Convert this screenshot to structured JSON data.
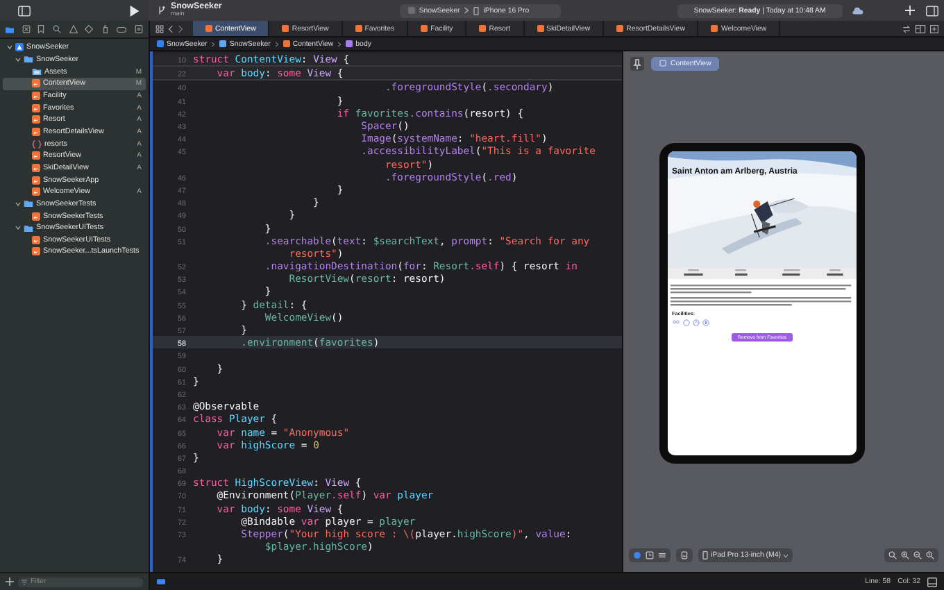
{
  "toolbar": {
    "project": "SnowSeeker",
    "branch": "main",
    "scheme": "SnowSeeker",
    "destination": "iPhone 16 Pro",
    "activity": "SnowSeeker: **Ready** | Today at 10:48 AM"
  },
  "tabs": [
    {
      "label": "ContentView",
      "selected": true
    },
    {
      "label": "ResortView",
      "selected": false
    },
    {
      "label": "Favorites",
      "selected": false
    },
    {
      "label": "Facility",
      "selected": false
    },
    {
      "label": "Resort",
      "selected": false
    },
    {
      "label": "SkiDetailView",
      "selected": false
    },
    {
      "label": "ResortDetailsView",
      "selected": false
    },
    {
      "label": "WelcomeView",
      "selected": false
    }
  ],
  "breadcrumb": [
    {
      "label": "SnowSeeker",
      "kind": "project"
    },
    {
      "label": "SnowSeeker",
      "kind": "folder"
    },
    {
      "label": "ContentView",
      "kind": "swift"
    },
    {
      "label": "body",
      "kind": "property"
    }
  ],
  "navigator": {
    "items": [
      {
        "label": "SnowSeeker",
        "kind": "project",
        "expanded": true,
        "selected": false,
        "children": [
          {
            "label": "SnowSeeker",
            "kind": "folder",
            "expanded": true,
            "selected": false,
            "children": [
              {
                "label": "Assets",
                "kind": "assets",
                "status": "M",
                "selected": false
              },
              {
                "label": "ContentView",
                "kind": "swift",
                "status": "M",
                "selected": true
              },
              {
                "label": "Facility",
                "kind": "swift",
                "status": "A",
                "selected": false
              },
              {
                "label": "Favorites",
                "kind": "swift",
                "status": "A",
                "selected": false
              },
              {
                "label": "Resort",
                "kind": "swift",
                "status": "A",
                "selected": false
              },
              {
                "label": "ResortDetailsView",
                "kind": "swift",
                "status": "A",
                "selected": false
              },
              {
                "label": "resorts",
                "kind": "json",
                "status": "A",
                "selected": false
              },
              {
                "label": "ResortView",
                "kind": "swift",
                "status": "A",
                "selected": false
              },
              {
                "label": "SkiDetailView",
                "kind": "swift",
                "status": "A",
                "selected": false
              },
              {
                "label": "SnowSeekerApp",
                "kind": "swift",
                "selected": false
              },
              {
                "label": "WelcomeView",
                "kind": "swift",
                "status": "A",
                "selected": false
              }
            ]
          },
          {
            "label": "SnowSeekerTests",
            "kind": "folder",
            "expanded": true,
            "selected": false,
            "children": [
              {
                "label": "SnowSeekerTests",
                "kind": "swift",
                "selected": false
              }
            ]
          },
          {
            "label": "SnowSeekerUITests",
            "kind": "folder",
            "expanded": true,
            "selected": false,
            "children": [
              {
                "label": "SnowSeekerUITests",
                "kind": "swift",
                "selected": false
              },
              {
                "label": "SnowSeeker...tsLaunchTests",
                "kind": "swift",
                "selected": false
              }
            ]
          }
        ]
      }
    ],
    "filter": {
      "placeholder": "Filter"
    }
  },
  "editor": {
    "lines": [
      {
        "n": "10",
        "kind": "sticky",
        "t": [
          {
            "kind": "kw",
            "text": "struct"
          },
          {
            "kind": "decl",
            "text": " ContentView"
          },
          {
            "kind": "p",
            "text": ": "
          },
          {
            "kind": "type",
            "text": "View"
          },
          {
            "kind": "p",
            "text": " {"
          }
        ]
      },
      {
        "n": "22",
        "kind": "sticky",
        "t": [
          {
            "kind": "kw",
            "text": "    var"
          },
          {
            "kind": "decl",
            "text": " body"
          },
          {
            "kind": "p",
            "text": ": "
          },
          {
            "kind": "kw",
            "text": "some"
          },
          {
            "kind": "type",
            "text": " View"
          },
          {
            "kind": "p",
            "text": " {"
          }
        ]
      },
      {
        "n": "40",
        "kind": "code",
        "t": [
          {
            "kind": "sys",
            "text": "                                .foregroundStyle"
          },
          {
            "kind": "p",
            "text": "("
          },
          {
            "kind": "sys",
            "text": ".secondary"
          },
          {
            "kind": "p",
            "text": ")"
          }
        ]
      },
      {
        "n": "41",
        "kind": "code",
        "t": [
          {
            "kind": "p",
            "text": "                        }"
          }
        ]
      },
      {
        "n": "42",
        "kind": "code",
        "t": [
          {
            "kind": "kw",
            "text": "                        if"
          },
          {
            "kind": "proj",
            "text": " favorites"
          },
          {
            "kind": "sys",
            "text": ".contains"
          },
          {
            "kind": "p",
            "text": "(resort) {"
          }
        ]
      },
      {
        "n": "43",
        "kind": "code",
        "t": [
          {
            "kind": "sys",
            "text": "                            Spacer"
          },
          {
            "kind": "p",
            "text": "()"
          }
        ]
      },
      {
        "n": "44",
        "kind": "code",
        "t": [
          {
            "kind": "sys",
            "text": "                            Image"
          },
          {
            "kind": "p",
            "text": "("
          },
          {
            "kind": "sys",
            "text": "systemName"
          },
          {
            "kind": "p",
            "text": ": "
          },
          {
            "kind": "str",
            "text": "\"heart.fill\""
          },
          {
            "kind": "p",
            "text": ")"
          }
        ]
      },
      {
        "n": "45",
        "kind": "code",
        "t": [
          {
            "kind": "sys",
            "text": "                            .accessibilityLabel"
          },
          {
            "kind": "p",
            "text": "("
          },
          {
            "kind": "str",
            "text": "\"This is a favorite"
          }
        ]
      },
      {
        "kind": "wrap",
        "t": [
          {
            "kind": "str",
            "text": "                                resort\""
          },
          {
            "kind": "p",
            "text": ")"
          }
        ]
      },
      {
        "n": "46",
        "kind": "code",
        "t": [
          {
            "kind": "sys",
            "text": "                                .foregroundStyle"
          },
          {
            "kind": "p",
            "text": "("
          },
          {
            "kind": "sys",
            "text": ".red"
          },
          {
            "kind": "p",
            "text": ")"
          }
        ]
      },
      {
        "n": "47",
        "kind": "code",
        "t": [
          {
            "kind": "p",
            "text": "                        }"
          }
        ]
      },
      {
        "n": "48",
        "kind": "code",
        "t": [
          {
            "kind": "p",
            "text": "                    }"
          }
        ]
      },
      {
        "n": "49",
        "kind": "code",
        "t": [
          {
            "kind": "p",
            "text": "                }"
          }
        ]
      },
      {
        "n": "50",
        "kind": "code",
        "t": [
          {
            "kind": "p",
            "text": "            }"
          }
        ]
      },
      {
        "n": "51",
        "kind": "code",
        "t": [
          {
            "kind": "sys",
            "text": "            .searchable"
          },
          {
            "kind": "p",
            "text": "("
          },
          {
            "kind": "sys",
            "text": "text"
          },
          {
            "kind": "p",
            "text": ": "
          },
          {
            "kind": "proj",
            "text": "$searchText"
          },
          {
            "kind": "p",
            "text": ", "
          },
          {
            "kind": "sys",
            "text": "prompt"
          },
          {
            "kind": "p",
            "text": ": "
          },
          {
            "kind": "str",
            "text": "\"Search for any"
          }
        ]
      },
      {
        "kind": "wrap",
        "t": [
          {
            "kind": "str",
            "text": "                resorts\""
          },
          {
            "kind": "p",
            "text": ")"
          }
        ]
      },
      {
        "n": "52",
        "kind": "code",
        "t": [
          {
            "kind": "sys",
            "text": "            .navigationDestination"
          },
          {
            "kind": "p",
            "text": "("
          },
          {
            "kind": "sys",
            "text": "for"
          },
          {
            "kind": "p",
            "text": ": "
          },
          {
            "kind": "proj",
            "text": "Resort"
          },
          {
            "kind": "kw",
            "text": ".self"
          },
          {
            "kind": "p",
            "text": ") { resort "
          },
          {
            "kind": "kw",
            "text": "in"
          }
        ]
      },
      {
        "n": "53",
        "kind": "code",
        "t": [
          {
            "kind": "proj",
            "text": "                ResortView"
          },
          {
            "kind": "p",
            "text": "("
          },
          {
            "kind": "proj",
            "text": "resort"
          },
          {
            "kind": "p",
            "text": ": resort)"
          }
        ]
      },
      {
        "n": "54",
        "kind": "code",
        "t": [
          {
            "kind": "p",
            "text": "            }"
          }
        ]
      },
      {
        "n": "55",
        "kind": "code",
        "t": [
          {
            "kind": "p",
            "text": "        } "
          },
          {
            "kind": "proj",
            "text": "detail"
          },
          {
            "kind": "p",
            "text": ": {"
          }
        ]
      },
      {
        "n": "56",
        "kind": "code",
        "t": [
          {
            "kind": "proj",
            "text": "            WelcomeView"
          },
          {
            "kind": "p",
            "text": "()"
          }
        ]
      },
      {
        "n": "57",
        "kind": "code",
        "t": [
          {
            "kind": "p",
            "text": "        }"
          }
        ]
      },
      {
        "n": "58",
        "kind": "current",
        "t": [
          {
            "kind": "proj",
            "text": "        .environment"
          },
          {
            "kind": "p",
            "text": "("
          },
          {
            "kind": "proj",
            "text": "favorites"
          },
          {
            "kind": "p",
            "text": ")"
          }
        ]
      },
      {
        "n": "59",
        "kind": "code"
      },
      {
        "n": "60",
        "kind": "code",
        "t": [
          {
            "kind": "p",
            "text": "    }"
          }
        ]
      },
      {
        "n": "61",
        "kind": "code",
        "t": [
          {
            "kind": "p",
            "text": "}"
          }
        ]
      },
      {
        "n": "62",
        "kind": "code"
      },
      {
        "n": "63",
        "kind": "code",
        "t": [
          {
            "kind": "p",
            "text": "@Observable"
          }
        ]
      },
      {
        "n": "64",
        "kind": "code",
        "t": [
          {
            "kind": "kw",
            "text": "class"
          },
          {
            "kind": "decl",
            "text": " Player"
          },
          {
            "kind": "p",
            "text": " {"
          }
        ]
      },
      {
        "n": "65",
        "kind": "code",
        "t": [
          {
            "kind": "kw",
            "text": "    var"
          },
          {
            "kind": "decl",
            "text": " name"
          },
          {
            "kind": "p",
            "text": " = "
          },
          {
            "kind": "str",
            "text": "\"Anonymous\""
          }
        ]
      },
      {
        "n": "66",
        "kind": "code",
        "t": [
          {
            "kind": "kw",
            "text": "    var"
          },
          {
            "kind": "decl",
            "text": " highScore"
          },
          {
            "kind": "p",
            "text": " = "
          },
          {
            "kind": "num",
            "text": "0"
          }
        ]
      },
      {
        "n": "67",
        "kind": "code",
        "t": [
          {
            "kind": "p",
            "text": "}"
          }
        ]
      },
      {
        "n": "68",
        "kind": "code"
      },
      {
        "n": "69",
        "kind": "code",
        "t": [
          {
            "kind": "kw",
            "text": "struct"
          },
          {
            "kind": "decl",
            "text": " HighScoreView"
          },
          {
            "kind": "p",
            "text": ": "
          },
          {
            "kind": "type",
            "text": "View"
          },
          {
            "kind": "p",
            "text": " {"
          }
        ]
      },
      {
        "n": "70",
        "kind": "code",
        "t": [
          {
            "kind": "p",
            "text": "    @Environment("
          },
          {
            "kind": "proj",
            "text": "Player"
          },
          {
            "kind": "kw",
            "text": ".self"
          },
          {
            "kind": "p",
            "text": ") "
          },
          {
            "kind": "kw",
            "text": "var"
          },
          {
            "kind": "decl",
            "text": " player"
          }
        ]
      },
      {
        "n": "71",
        "kind": "code",
        "t": [
          {
            "kind": "kw",
            "text": "    var"
          },
          {
            "kind": "decl",
            "text": " body"
          },
          {
            "kind": "p",
            "text": ": "
          },
          {
            "kind": "kw",
            "text": "some"
          },
          {
            "kind": "type",
            "text": " View"
          },
          {
            "kind": "p",
            "text": " {"
          }
        ]
      },
      {
        "n": "72",
        "kind": "code",
        "t": [
          {
            "kind": "p",
            "text": "        @Bindable "
          },
          {
            "kind": "kw",
            "text": "var"
          },
          {
            "kind": "p",
            "text": " player = "
          },
          {
            "kind": "proj",
            "text": "player"
          }
        ]
      },
      {
        "n": "73",
        "kind": "code",
        "t": [
          {
            "kind": "sys",
            "text": "        Stepper"
          },
          {
            "kind": "p",
            "text": "("
          },
          {
            "kind": "str",
            "text": "\"Your high score : \\("
          },
          {
            "kind": "p",
            "text": "player."
          },
          {
            "kind": "proj",
            "text": "highScore"
          },
          {
            "kind": "str",
            "text": ")\""
          },
          {
            "kind": "p",
            "text": ", "
          },
          {
            "kind": "sys",
            "text": "value"
          },
          {
            "kind": "p",
            "text": ":"
          }
        ]
      },
      {
        "kind": "wrap",
        "t": [
          {
            "kind": "proj",
            "text": "            $player.highScore"
          },
          {
            "kind": "p",
            "text": ")"
          }
        ]
      },
      {
        "n": "74",
        "kind": "code",
        "t": [
          {
            "kind": "p",
            "text": "    }"
          }
        ]
      }
    ]
  },
  "preview": {
    "label": "ContentView",
    "screen": {
      "title": "Saint Anton am Arlberg, Austria",
      "section": "Facilities:",
      "button": "Remove from Favorites"
    },
    "device": "iPad Pro 13-inch (M4)"
  },
  "status_bar": {
    "line": "Line: 58",
    "col": "Col: 32"
  }
}
